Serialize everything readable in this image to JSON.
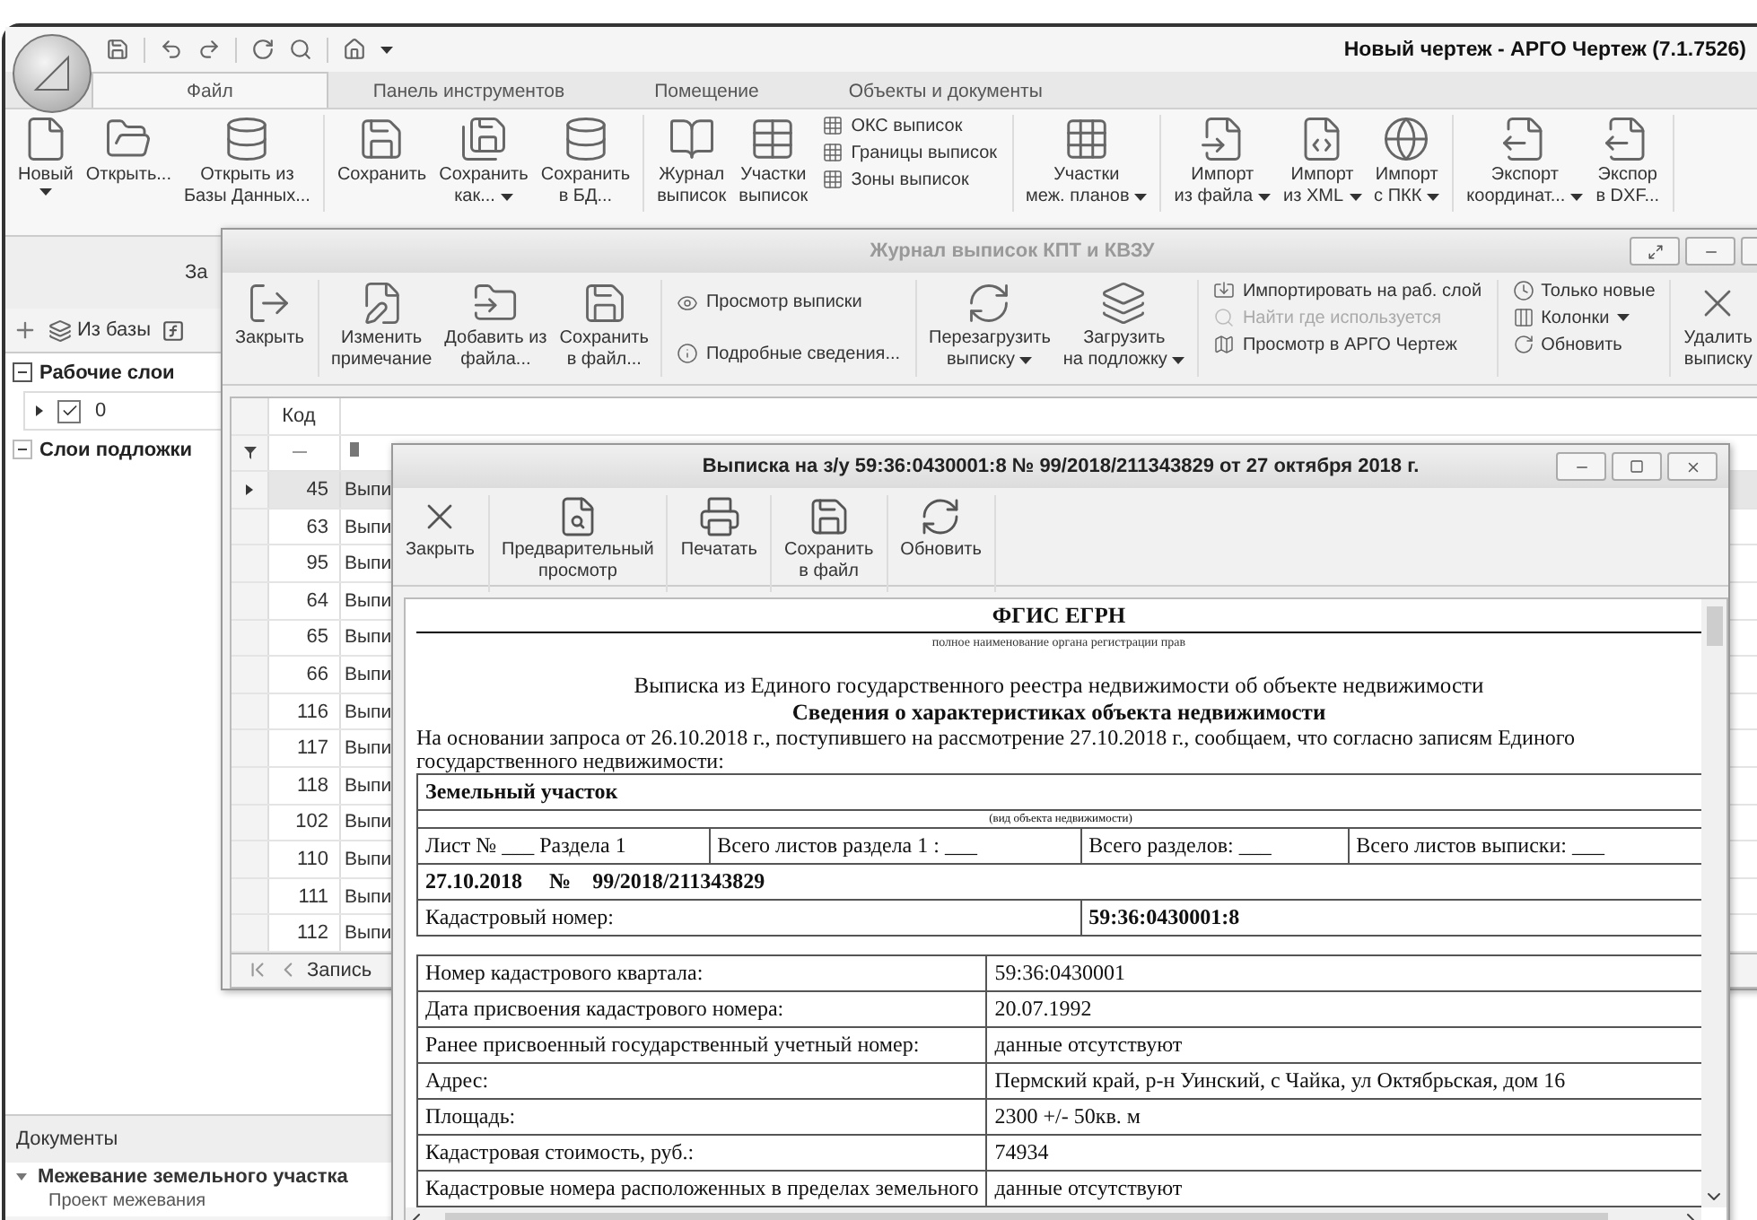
{
  "window": {
    "title": "Новый чертеж - АРГО Чертеж (7.1.7526)"
  },
  "ribbon": {
    "tabs": [
      {
        "label": "Файл",
        "selected": true
      },
      {
        "label": "Панель инструментов",
        "selected": false
      },
      {
        "label": "Помещение",
        "selected": false
      },
      {
        "label": "Объекты и документы",
        "selected": false
      }
    ],
    "groups": [
      {
        "items": [
          {
            "kind": "large",
            "label": "Новый",
            "dropdown": true
          },
          {
            "kind": "large",
            "label": "Открыть...",
            "dropdown": false
          },
          {
            "kind": "large",
            "label": "Открыть из\nБазы Данных...",
            "dropdown": false
          }
        ]
      },
      {
        "items": [
          {
            "kind": "large",
            "label": "Сохранить",
            "dropdown": false
          },
          {
            "kind": "large",
            "label": "Сохранить\nкак...",
            "dropdown": true
          },
          {
            "kind": "large",
            "label": "Сохранить\nв БД...",
            "dropdown": false
          }
        ]
      },
      {
        "items": [
          {
            "kind": "large",
            "label": "Журнал\nвыписок",
            "dropdown": false
          },
          {
            "kind": "large",
            "label": "Участки\nвыписок",
            "dropdown": false
          },
          {
            "kind": "small",
            "label": "ОКС выписок",
            "dropdown": false
          },
          {
            "kind": "small",
            "label": "Границы выписок",
            "dropdown": false
          },
          {
            "kind": "small",
            "label": "Зоны выписок",
            "dropdown": false
          }
        ]
      },
      {
        "items": [
          {
            "kind": "large",
            "label": "Участки\nмеж. планов",
            "dropdown": true
          }
        ]
      },
      {
        "items": [
          {
            "kind": "large",
            "label": "Импорт\nиз файла",
            "dropdown": true
          },
          {
            "kind": "large",
            "label": "Импорт\nиз XML",
            "dropdown": true
          },
          {
            "kind": "large",
            "label": "Импорт\nс ПКК",
            "dropdown": true
          }
        ]
      },
      {
        "items": [
          {
            "kind": "large",
            "label": "Экспорт\nкоординат...",
            "dropdown": true
          },
          {
            "kind": "large",
            "label": "Экспор\nв DXF...",
            "dropdown": false
          }
        ]
      }
    ]
  },
  "layers_panel": {
    "title": "За",
    "toolbar": [
      {
        "label": "Из базы"
      }
    ],
    "tree": [
      {
        "label": "Рабочие слои",
        "expanded": true,
        "children": [
          {
            "label": "0",
            "checked": true
          }
        ]
      },
      {
        "label": "Слои подложки",
        "expanded": true
      }
    ]
  },
  "documents": {
    "title": "Документы",
    "groups": [
      {
        "label": "Межевание земельного участка",
        "expanded": true,
        "children": [
          {
            "label": "Проект межевания"
          }
        ]
      }
    ]
  },
  "journal": {
    "title": "Журнал выписок КПТ и КВЗУ",
    "toolbar": [
      {
        "items": [
          {
            "kind": "large",
            "label": "Закрыть",
            "dropdown": false,
            "disabled": false
          }
        ]
      },
      {
        "items": [
          {
            "kind": "large",
            "label": "Изменить\nпримечание",
            "dropdown": false,
            "disabled": false
          },
          {
            "kind": "large",
            "label": "Добавить из\nфайла...",
            "dropdown": false,
            "disabled": false
          },
          {
            "kind": "large",
            "label": "Сохранить\nв файл...",
            "dropdown": false,
            "disabled": false
          }
        ]
      },
      {
        "items": [
          {
            "kind": "small",
            "label": "Просмотр выписки",
            "dropdown": false,
            "disabled": false
          },
          {
            "kind": "small",
            "label": "Подробные сведения...",
            "dropdown": false,
            "disabled": false
          }
        ]
      },
      {
        "items": [
          {
            "kind": "large",
            "label": "Перезагрузить\nвыписку",
            "dropdown": true,
            "disabled": false
          },
          {
            "kind": "large",
            "label": "Загрузить\nна подложку",
            "dropdown": true,
            "disabled": false
          }
        ]
      },
      {
        "items": [
          {
            "kind": "small",
            "label": "Импортировать на раб. слой",
            "dropdown": false,
            "disabled": false
          },
          {
            "kind": "small",
            "label": "Найти где используется",
            "dropdown": false,
            "disabled": true
          },
          {
            "kind": "small",
            "label": "Просмотр в АРГО Чертеж",
            "dropdown": false,
            "disabled": false
          }
        ]
      },
      {
        "items": [
          {
            "kind": "small",
            "label": "Только новые",
            "dropdown": false,
            "disabled": false
          },
          {
            "kind": "small",
            "label": "Колонки",
            "dropdown": true,
            "disabled": false
          },
          {
            "kind": "small",
            "label": "Обновить",
            "dropdown": false,
            "disabled": false
          }
        ]
      },
      {
        "items": [
          {
            "kind": "large",
            "label": "Удалить\nвыписку",
            "dropdown": false,
            "disabled": false
          }
        ]
      }
    ],
    "grid": {
      "columns": [
        "Код"
      ],
      "rows": [
        {
          "code": "45",
          "text": "Выпи",
          "selected": true
        },
        {
          "code": "63",
          "text": "Выпи",
          "selected": false
        },
        {
          "code": "95",
          "text": "Выпи",
          "selected": false
        },
        {
          "code": "64",
          "text": "Выпи",
          "selected": false
        },
        {
          "code": "65",
          "text": "Выпи",
          "selected": false
        },
        {
          "code": "66",
          "text": "Выпи",
          "selected": false
        },
        {
          "code": "116",
          "text": "Выпи",
          "selected": false
        },
        {
          "code": "117",
          "text": "Выпи",
          "selected": false
        },
        {
          "code": "118",
          "text": "Выпи",
          "selected": false
        },
        {
          "code": "102",
          "text": "Выпи",
          "selected": false
        },
        {
          "code": "110",
          "text": "Выпи",
          "selected": false
        },
        {
          "code": "111",
          "text": "Выпи",
          "selected": false
        },
        {
          "code": "112",
          "text": "Выпи",
          "selected": false
        }
      ]
    },
    "pager": {
      "label": "Запись"
    }
  },
  "extract": {
    "title": "Выписка на з/у 59:36:0430001:8 № 99/2018/211343829 от 27 октября 2018 г.",
    "toolbar": [
      {
        "label": "Закрыть"
      },
      {
        "label": "Предварительный\nпросмотр"
      },
      {
        "label": "Печатать"
      },
      {
        "label": "Сохранить\nв файл"
      },
      {
        "label": "Обновить"
      }
    ],
    "document": {
      "org": "ФГИС ЕГРН",
      "org_caption": "полное наименование органа регистрации прав",
      "title": "Выписка из Единого государственного реестра недвижимости об объекте недвижимости",
      "subtitle": "Сведения о характеристиках объекта недвижимости",
      "intro": "На основании запроса от 26.10.2018 г., поступившего на рассмотрение 27.10.2018 г., сообщаем, что согласно записям Единого государственного недвижимости:",
      "object_type": "Земельный участок",
      "object_caption": "(вид объекта недвижимости)",
      "sheet_row": [
        "Лист № ___ Раздела 1",
        "Всего листов раздела 1 : ___",
        "Всего разделов: ___",
        "Всего листов выписки: ___"
      ],
      "date": "27.10.2018",
      "number_sign": "№",
      "number": "99/2018/211343829",
      "cadastral": {
        "label": "Кадастровый номер:",
        "value": "59:36:0430001:8"
      },
      "properties": [
        {
          "label": "Номер кадастрового квартала:",
          "value": "59:36:0430001"
        },
        {
          "label": "Дата присвоения кадастрового номера:",
          "value": "20.07.1992"
        },
        {
          "label": "Ранее присвоенный государственный учетный номер:",
          "value": "данные отсутствуют"
        },
        {
          "label": "Адрес:",
          "value": "Пермский край, р-н Уинский, с Чайка, ул Октябрьская, дом 16"
        },
        {
          "label": "Площадь:",
          "value": "2300 +/- 50кв. м"
        },
        {
          "label": "Кадастровая стоимость, руб.:",
          "value": "74934"
        },
        {
          "label": "Кадастровые номера расположенных в пределах земельного",
          "value": "данные отсутствуют"
        }
      ]
    }
  }
}
